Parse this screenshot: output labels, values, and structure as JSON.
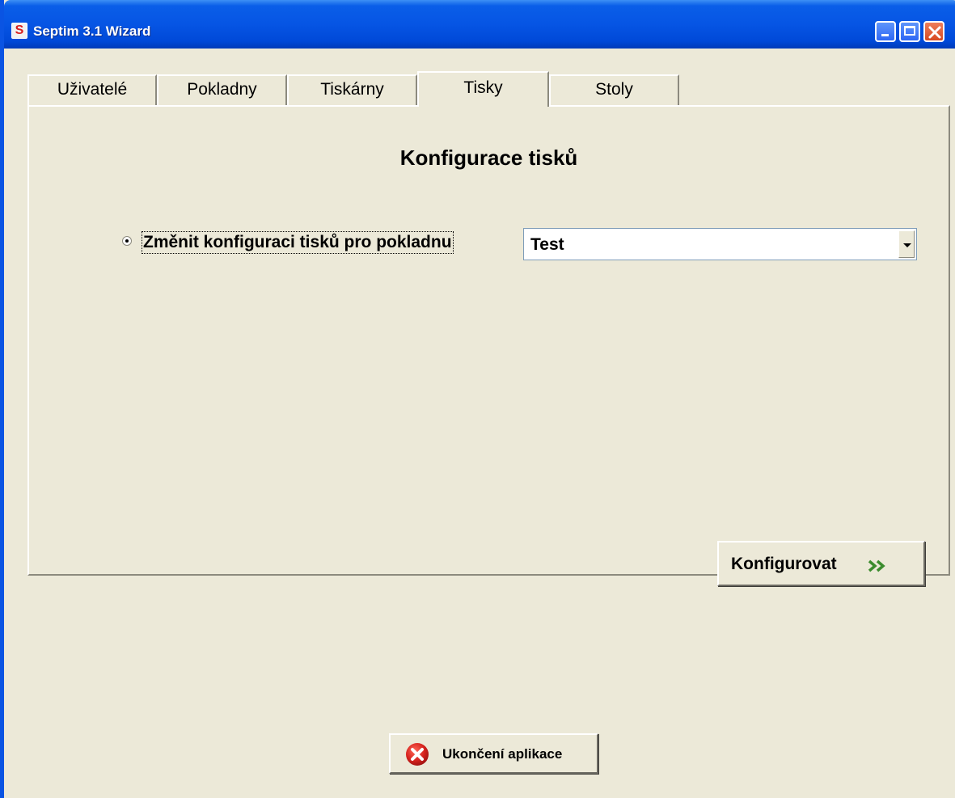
{
  "window": {
    "title": "Septim 3.1 Wizard",
    "app_icon_letter": "S"
  },
  "tabs": [
    {
      "label": "Uživatelé",
      "active": false
    },
    {
      "label": "Pokladny",
      "active": false
    },
    {
      "label": "Tiskárny",
      "active": false
    },
    {
      "label": "Tisky",
      "active": true
    },
    {
      "label": "Stoly",
      "active": false
    }
  ],
  "panel": {
    "heading": "Konfigurace tisků",
    "radio_label": "Změnit konfiguraci tisků pro pokladnu",
    "radio_checked": true,
    "combo_value": "Test",
    "configure_label": "Konfigurovat",
    "configure_icon": "double-chevron-right-icon"
  },
  "footer": {
    "exit_label": "Ukončení aplikace",
    "exit_icon": "red-close-circle-icon"
  },
  "colors": {
    "titlebar": "#0655e4",
    "background": "#ece9d8",
    "exit_icon": "#cc1f1f",
    "arrow_icon": "#3c8c2e"
  }
}
